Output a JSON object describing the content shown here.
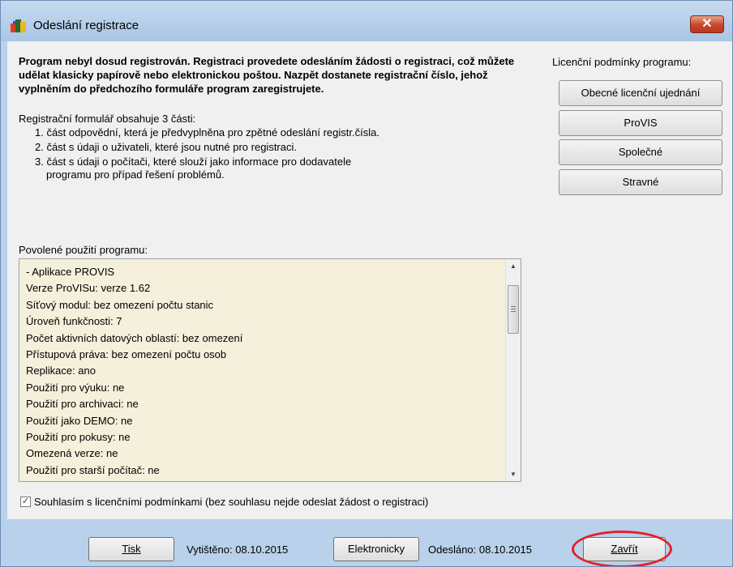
{
  "window": {
    "title": "Odeslání registrace",
    "close_label": "✕",
    "icon": "app-logo-icon"
  },
  "intro": {
    "text": "Program nebyl dosud registrován. Registraci provedete odesláním žádosti o registraci, což můžete udělat klasicky papírově nebo elektronickou poštou. Nazpět dostanete registrační číslo, jehož vyplněním do předchozího formuláře program zaregistrujete."
  },
  "parts": {
    "title": "Registrační formulář obsahuje 3 části:",
    "items": [
      {
        "line1": "1. část odpovědní, která je předvyplněna pro zpětné odeslání registr.čísla.",
        "line2": ""
      },
      {
        "line1": "2. část s údaji o uživateli, které jsou nutné pro registraci.",
        "line2": ""
      },
      {
        "line1": "3. část s údaji o počítači, které slouží jako informace pro dodavatele",
        "line2": "programu pro případ řešení problémů."
      }
    ]
  },
  "license": {
    "title": "Licenční podmínky programu:",
    "buttons": [
      "Obecné licenční ujednání",
      "ProVIS",
      "Společné",
      "Stravné"
    ]
  },
  "usage": {
    "label": "Povolené použití programu:",
    "lines": [
      "- Aplikace PROVIS",
      "Verze ProVISu: verze 1.62",
      "Síťový modul: bez omezení počtu stanic",
      "Úroveň funkčnosti: 7",
      "Počet aktivních datových oblastí: bez omezení",
      "Přístupová práva: bez omezení počtu osob",
      "Replikace: ano",
      "Použití pro výuku: ne",
      "Použití pro archivaci: ne",
      "Použití jako DEMO: ne",
      "Použití pro pokusy: ne",
      "Omezená verze: ne",
      "Použití pro starší počítač: ne"
    ]
  },
  "consent": {
    "checked": true,
    "text": "Souhlasím s licenčními podmínkami (bez souhlasu nejde odeslat žádost o registraci)"
  },
  "footer": {
    "print_label": "Tisk",
    "printed_status": "Vytištěno: 08.10.2015",
    "electronic_label": "Elektronicky",
    "sent_status": "Odesláno: 08.10.2015",
    "close_label": "Zavřít"
  },
  "colors": {
    "frame": "#b9d1ea",
    "client": "#f0f0f0",
    "listbox": "#f5f0dc",
    "highlight": "#e4202b"
  }
}
